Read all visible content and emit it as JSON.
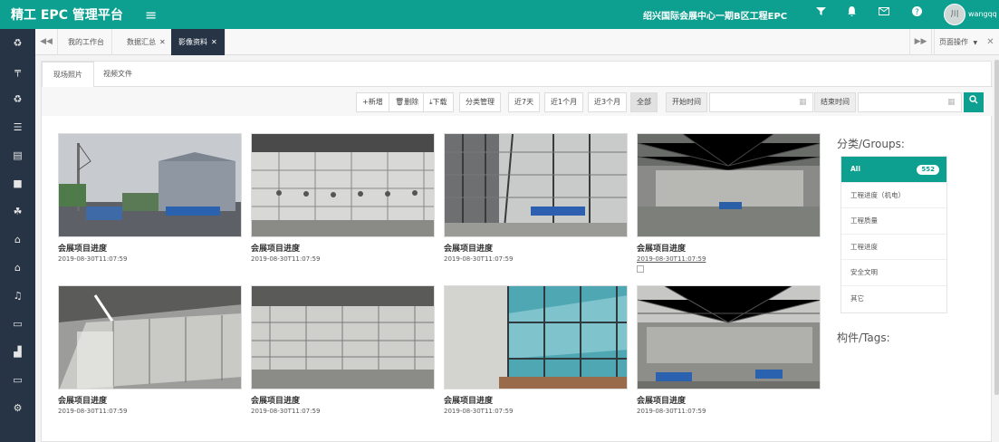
{
  "app": {
    "title": "精工 EPC 管理平台",
    "project": "绍兴国际会展中心一期B区工程EPC",
    "user": "wangqq",
    "avatar_text": "川",
    "colors": {
      "accent": "#0d9f8f",
      "sidebar": "#263445"
    }
  },
  "tabs": [
    {
      "label": "我的工作台",
      "closable": false
    },
    {
      "label": "数据汇总",
      "closable": true
    },
    {
      "label": "影像资料",
      "closable": true,
      "active": true
    }
  ],
  "page_ops": "页面操作",
  "subtabs": [
    "现场照片",
    "视频文件"
  ],
  "toolbar": {
    "new": "+新增",
    "delete": "删除",
    "download": "下载",
    "category": "分类管理",
    "week": "近7天",
    "month1": "近1个月",
    "month3": "近3个月",
    "all": "全部",
    "start_label": "开始时间",
    "end_label": "结束时间"
  },
  "photos": [
    {
      "title": "会展项目进度",
      "date": "2019-08-30T11:07:59"
    },
    {
      "title": "会展项目进度",
      "date": "2019-08-30T11:07:59"
    },
    {
      "title": "会展项目进度",
      "date": "2019-08-30T11:07:59"
    },
    {
      "title": "会展项目进度",
      "date": "2019-08-30T11:07:59"
    },
    {
      "title": "会展项目进度",
      "date": "2019-08-30T11:07:59"
    },
    {
      "title": "会展项目进度",
      "date": "2019-08-30T11:07:59"
    },
    {
      "title": "会展项目进度",
      "date": "2019-08-30T11:07:59"
    },
    {
      "title": "会展项目进度",
      "date": "2019-08-30T11:07:59"
    }
  ],
  "groups": {
    "title": "分类/Groups:",
    "items": [
      {
        "label": "All",
        "count": "552"
      },
      {
        "label": "工程进度（机电）"
      },
      {
        "label": "工程质量"
      },
      {
        "label": "工程进度"
      },
      {
        "label": "安全文明"
      },
      {
        "label": "其它"
      }
    ]
  },
  "tags_title": "构件/Tags:",
  "icons": {
    "sidebar": [
      "recycle-icon",
      "tools-icon",
      "recycle-icon",
      "database-icon",
      "building-icon",
      "briefcase-icon",
      "sitemap-icon",
      "bank-icon",
      "bank-icon",
      "bell-icon",
      "monitor-icon",
      "chart-icon",
      "monitor-icon",
      "gears-icon"
    ],
    "top": [
      "filter-icon",
      "bell-icon",
      "mail-icon",
      "help-icon"
    ]
  }
}
